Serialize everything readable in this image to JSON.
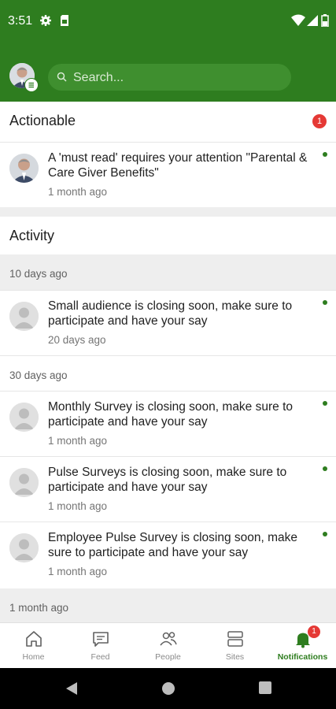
{
  "status_bar": {
    "time": "3:51",
    "icons": [
      "gear-icon",
      "sim-card-icon",
      "wifi-icon",
      "signal-icon",
      "battery-icon"
    ]
  },
  "header": {
    "search_placeholder": "Search..."
  },
  "actionable": {
    "title": "Actionable",
    "badge_count": "1",
    "items": [
      {
        "text": "A 'must read' requires your attention \"Parental & Care Giver Benefits\"",
        "time": "1 month ago",
        "unread": true
      }
    ]
  },
  "activity": {
    "title": "Activity",
    "groups": [
      {
        "label": "10 days ago"
      },
      {
        "label": "30 days ago"
      },
      {
        "label": "1 month ago"
      }
    ],
    "items": [
      {
        "text": "Small audience is closing soon, make sure to participate and have your say",
        "time": "20 days ago",
        "unread": true
      },
      {
        "text": "Monthly Survey is closing soon, make sure to participate and have your say",
        "time": "1 month ago",
        "unread": true
      },
      {
        "text": "Pulse Surveys is closing soon, make sure to participate and have your say",
        "time": "1 month ago",
        "unread": true
      },
      {
        "text": "Employee Pulse Survey is closing soon, make sure to participate and have your say",
        "time": "1 month ago",
        "unread": true
      }
    ]
  },
  "bottom_nav": {
    "items": [
      {
        "label": "Home",
        "icon": "home-icon"
      },
      {
        "label": "Feed",
        "icon": "chat-icon"
      },
      {
        "label": "People",
        "icon": "people-icon"
      },
      {
        "label": "Sites",
        "icon": "sites-icon"
      },
      {
        "label": "Notifications",
        "icon": "bell-icon",
        "badge": "1",
        "active": true
      }
    ]
  },
  "colors": {
    "brand_green": "#2e7d1f",
    "badge_red": "#e53935",
    "unread_dot": "#2e7d1f"
  }
}
